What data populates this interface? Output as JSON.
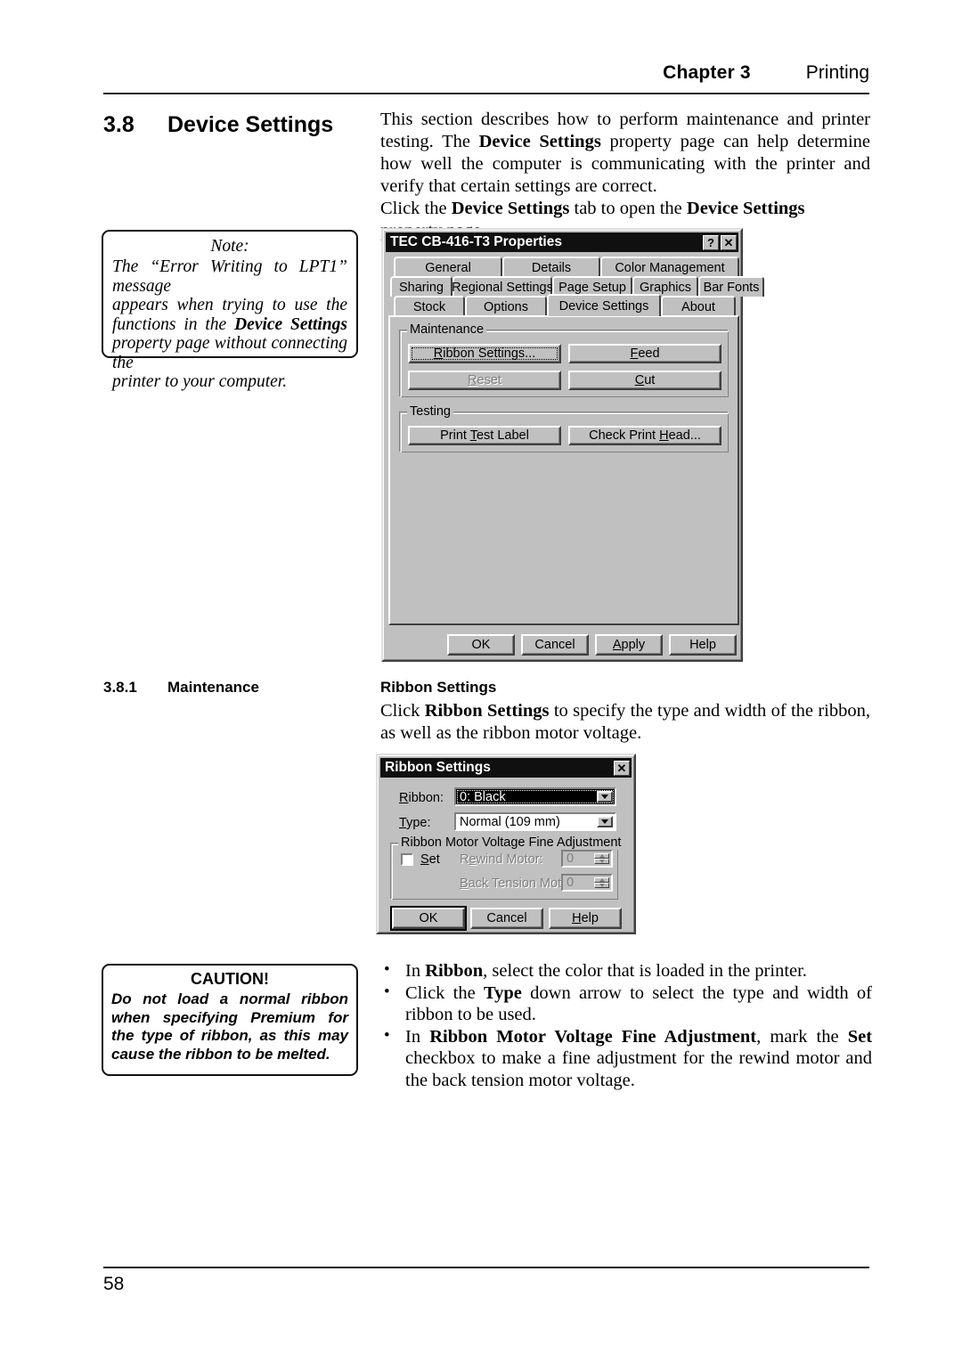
{
  "header": {
    "chapter": "Chapter 3",
    "section": "Printing"
  },
  "footer": {
    "page_number": "58"
  },
  "section": {
    "number": "3.8",
    "title": "Device Settings",
    "sub_number": "3.8.1",
    "sub_title": "Maintenance"
  },
  "intro": {
    "p1_a": "This section describes how to perform maintenance and printer testing. The ",
    "p1_b": "Device Settings",
    "p1_c": " property page can help determine how well the computer is communicating with the printer and verify that certain settings are correct.",
    "p2_a": "Click the ",
    "p2_b": "Device Settings",
    "p2_c": " tab to open the ",
    "p2_d": "Device Settings",
    "p2_e": " property page."
  },
  "note": {
    "title": "Note:",
    "line1": "The “Error Writing to LPT1” message",
    "line2": "appears when trying to use the",
    "line3_a": "functions in the ",
    "line3_b": "Device Settings",
    "line4": "property page without connecting the",
    "line5": "printer to your computer."
  },
  "caution": {
    "title": "CAUTION!",
    "line1": "Do not load a normal ribbon",
    "line2": "when specifying Premium for",
    "line3": "the type of ribbon, as this may",
    "line4": "cause the ribbon to be melted."
  },
  "ribbon_section": {
    "heading": "Ribbon Settings",
    "para_a": "Click ",
    "para_b": "Ribbon Settings",
    "para_c": " to specify the type and width of the ribbon, as well as the ribbon motor voltage."
  },
  "bullets": [
    {
      "a": "In ",
      "b": "Ribbon",
      "c": ", select the color that is loaded in the printer."
    },
    {
      "a": "Click the ",
      "b": "Type",
      "c": " down arrow to select the type and width of ribbon to be used."
    },
    {
      "a": "In ",
      "b": "Ribbon Motor Voltage Fine Adjustment",
      "c": ", mark the ",
      "d": "Set",
      "e": " checkbox to make a fine adjustment for the rewind motor and the back tension motor voltage."
    }
  ],
  "properties_dialog": {
    "title": "TEC CB-416-T3 Properties",
    "title_buttons": [
      {
        "name": "help-button",
        "glyph": "?"
      },
      {
        "name": "close-button",
        "glyph": "✕"
      }
    ],
    "tabs_row1": [
      "General",
      "Details",
      "Color Management"
    ],
    "tabs_row2": [
      "Sharing",
      "Regional Settings",
      "Page Setup",
      "Graphics",
      "Bar Fonts"
    ],
    "tabs_row3": [
      "Stock",
      "Options",
      "Device Settings",
      "About"
    ],
    "active_tab": "Device Settings",
    "maintenance": {
      "group_label": "Maintenance",
      "buttons": [
        {
          "label": "Ribbon Settings...",
          "accel": "R",
          "state": "focused"
        },
        {
          "label": "Feed",
          "accel": "F",
          "state": "normal"
        },
        {
          "label": "Reset",
          "accel": "R",
          "state": "disabled"
        },
        {
          "label": "Cut",
          "accel": "C",
          "state": "normal"
        }
      ]
    },
    "testing": {
      "group_label": "Testing",
      "buttons": [
        {
          "label": "Print Test Label",
          "accel": "T",
          "state": "normal"
        },
        {
          "label": "Check Print Head...",
          "accel": "H",
          "state": "normal"
        }
      ]
    },
    "footer_buttons": [
      {
        "label": "OK",
        "accel": ""
      },
      {
        "label": "Cancel",
        "accel": ""
      },
      {
        "label": "Apply",
        "accel": "A"
      },
      {
        "label": "Help",
        "accel": ""
      }
    ]
  },
  "ribbon_dialog": {
    "title": "Ribbon Settings",
    "close_glyph": "✕",
    "ribbon_label": "Ribbon:",
    "ribbon_label_accel": "R",
    "ribbon_value": "0: Black",
    "type_label": "Type:",
    "type_label_accel": "T",
    "type_value": "Normal (109 mm)",
    "group_label": "Ribbon Motor Voltage Fine Adjustment",
    "set_label": "Set",
    "set_accel": "S",
    "set_checked": false,
    "rewind_label": "Rewind Motor:",
    "rewind_value": "0",
    "back_tension_label": "Back Tension Motor:",
    "back_tension_value": "0",
    "buttons": [
      {
        "label": "OK",
        "default": true
      },
      {
        "label": "Cancel",
        "default": false
      },
      {
        "label": "Help",
        "default": false
      }
    ]
  },
  "colors": {
    "dialog_face": "#c0c0c0",
    "titlebar": "#101010",
    "shadow": "#808080",
    "ink": "#000000"
  }
}
